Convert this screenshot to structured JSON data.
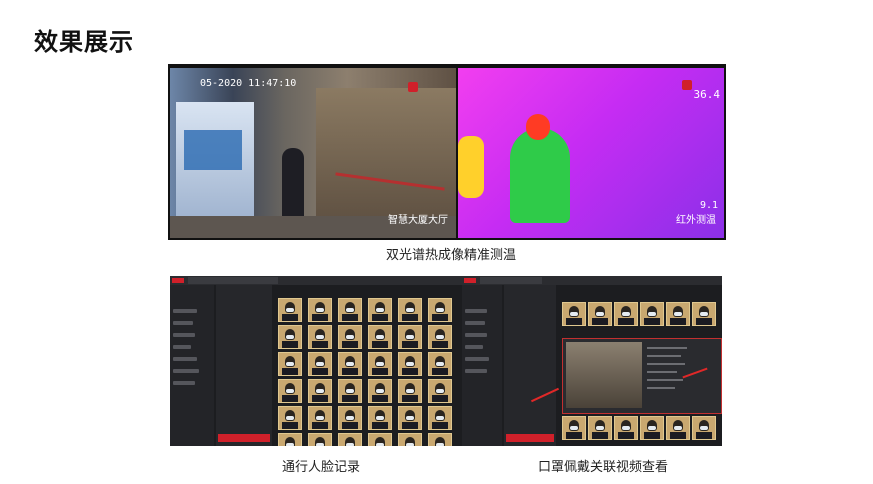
{
  "page": {
    "title": "效果展示"
  },
  "top_panel": {
    "caption": "双光谱热成像精准测温",
    "camera": {
      "timestamp": "05-2020 11:47:10",
      "label": "智慧大厦大厅"
    },
    "thermal": {
      "temperature": "36.4",
      "reading": "9.1",
      "label": "红外测温"
    }
  },
  "left_panel": {
    "caption": "通行人脸记录"
  },
  "right_panel": {
    "caption": "口罩佩戴关联视频查看"
  },
  "colors": {
    "accent": "#d0202a",
    "app_background": "#1c1d20",
    "thermal_magenta": "#f23ef0",
    "thermal_green": "#2fcb49"
  }
}
